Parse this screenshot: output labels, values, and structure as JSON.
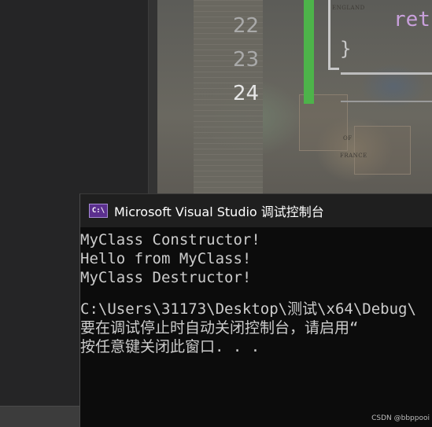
{
  "editor": {
    "line_numbers": [
      "22",
      "23",
      "24"
    ],
    "current_line": "24",
    "code_ret": "ret",
    "code_brace": "}",
    "map_labels": [
      "ENGLAND",
      "FRANCE",
      "OF"
    ]
  },
  "console": {
    "title": "Microsoft Visual Studio 调试控制台",
    "icon_text": "C:\\",
    "lines": [
      "MyClass Constructor!",
      "Hello from MyClass!",
      "MyClass Destructor!",
      "",
      "C:\\Users\\31173\\Desktop\\测试\\x64\\Debug\\",
      "要在调试停止时自动关闭控制台，请启用“",
      "按任意键关闭此窗口. . ."
    ]
  },
  "watermark": "CSDN @bbppooi"
}
